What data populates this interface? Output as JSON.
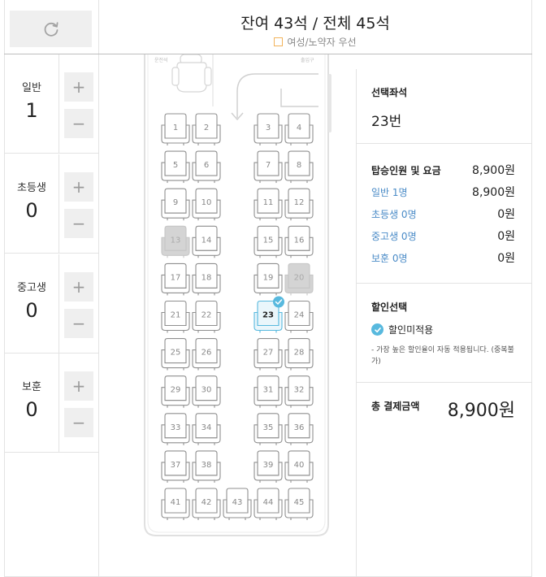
{
  "header": {
    "seat_summary": "잔여 43석 / 전체 45석",
    "priority_note": "여성/노약자 우선"
  },
  "passengers": [
    {
      "label": "일반",
      "count": "1"
    },
    {
      "label": "초등생",
      "count": "0"
    },
    {
      "label": "중고생",
      "count": "0"
    },
    {
      "label": "보훈",
      "count": "0"
    }
  ],
  "seatmap": {
    "driver_label": "운전석",
    "door_label": "출입구",
    "rows": [
      [
        1,
        2,
        null,
        3,
        4
      ],
      [
        5,
        6,
        null,
        7,
        8
      ],
      [
        9,
        10,
        null,
        11,
        12
      ],
      [
        13,
        14,
        null,
        15,
        16
      ],
      [
        17,
        18,
        null,
        19,
        20
      ],
      [
        21,
        22,
        null,
        23,
        24
      ],
      [
        25,
        26,
        null,
        27,
        28
      ],
      [
        29,
        30,
        null,
        31,
        32
      ],
      [
        33,
        34,
        null,
        35,
        36
      ],
      [
        37,
        38,
        null,
        39,
        40
      ],
      [
        41,
        42,
        43,
        44,
        45
      ]
    ],
    "taken": [
      13,
      20
    ],
    "selected": [
      23
    ]
  },
  "summary": {
    "selected_title": "선택좌석",
    "selected_value": "23번",
    "fare_title": "탑승인원 및 요금",
    "fare_total": "8,900원",
    "fare_rows": [
      {
        "label": "일반 1명",
        "value": "8,900원"
      },
      {
        "label": "초등생 0명",
        "value": "0원"
      },
      {
        "label": "중고생 0명",
        "value": "0원"
      },
      {
        "label": "보훈 0명",
        "value": "0원"
      }
    ],
    "discount_title": "할인선택",
    "discount_option": "할인미적용",
    "discount_note": "- 가장 높은 할인율이 자동 적용됩니다. (중복불가)",
    "payment_title": "총 결제금액",
    "payment_total": "8,900원"
  },
  "colors": {
    "accent": "#58b9de",
    "link_blue": "#4a8bc7",
    "taken_seat": "#d4d4d4",
    "priority_box": "#f2b35b"
  }
}
